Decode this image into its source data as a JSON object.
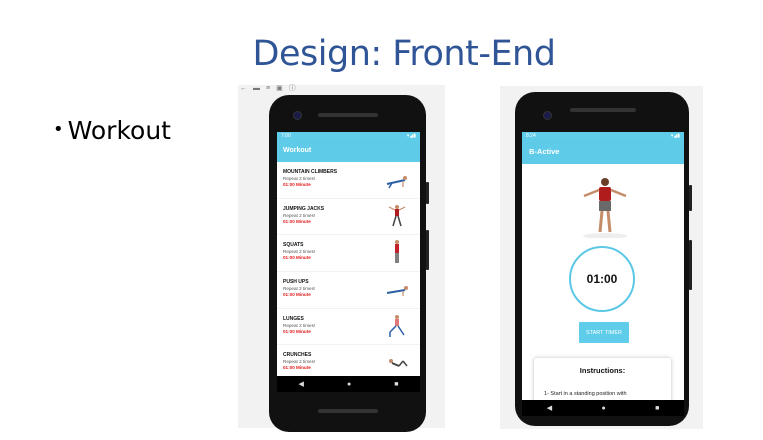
{
  "slide": {
    "title": "Design: Front-End",
    "bullet": "Workout"
  },
  "toolbar_icons": [
    "←",
    "▬",
    "≡",
    "▣",
    "ⓘ",
    "⋮"
  ],
  "phone_left": {
    "status": {
      "time": "7:00",
      "icons": "▾◢▮"
    },
    "app_title": "Workout",
    "exercises": [
      {
        "name": "MOUNTAIN CLIMBERS",
        "repeat": "Repeat 2 times!",
        "duration": "01:00 Minute",
        "icon": "mountain-climber-figure"
      },
      {
        "name": "JUMPING JACKS",
        "repeat": "Repeat 2 times!",
        "duration": "01:00 Minute",
        "icon": "jumping-jack-figure"
      },
      {
        "name": "SQUATS",
        "repeat": "Repeat 2 times!",
        "duration": "01:00 Minute",
        "icon": "squat-figure"
      },
      {
        "name": "PUSH UPS",
        "repeat": "Repeat 2 times!",
        "duration": "01:00 Minute",
        "icon": "push-up-figure"
      },
      {
        "name": "LUNGES",
        "repeat": "Repeat 2 times!",
        "duration": "01:00 Minute",
        "icon": "lunge-figure"
      },
      {
        "name": "CRUNCHES",
        "repeat": "Repeat 2 times!",
        "duration": "01:00 Minute",
        "icon": "crunch-figure"
      }
    ],
    "nav": {
      "back": "◀",
      "home": "●",
      "recents": "■"
    }
  },
  "phone_right": {
    "status": {
      "time": "8:24",
      "icons": "▾◢▮"
    },
    "app_title": "B-Active",
    "timer": "01:00",
    "start_button": "START TIMER",
    "instructions_heading": "Instructions:",
    "instructions_text": "1- Start in a standing position with",
    "nav": {
      "back": "◀",
      "home": "●",
      "recents": "■"
    }
  },
  "colors": {
    "title": "#2f5597",
    "accent": "#5ecbe9",
    "duration": "#e31c1c"
  }
}
